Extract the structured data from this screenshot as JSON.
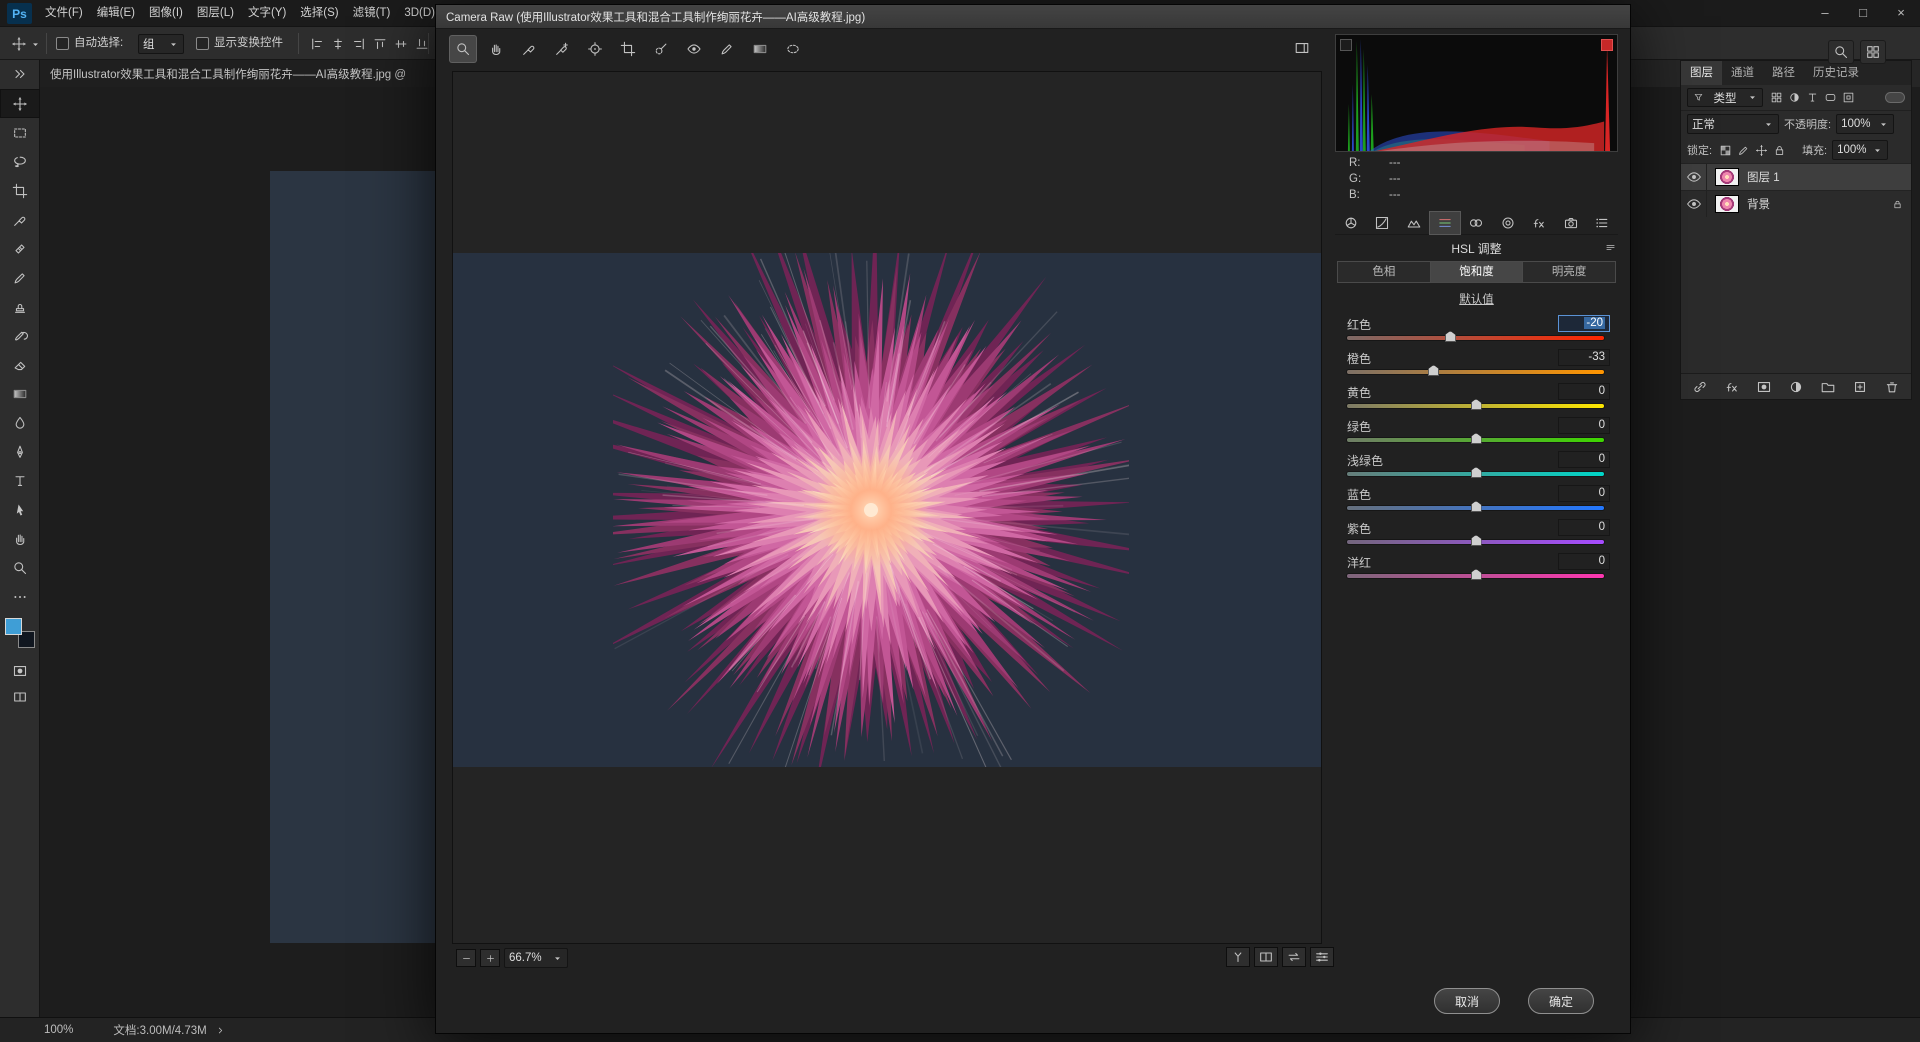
{
  "window_controls": {
    "minimize": "–",
    "maximize": "□",
    "close": "×"
  },
  "menu_bar": {
    "logo": "Ps",
    "items": [
      {
        "key": "file",
        "label": "文件(F)"
      },
      {
        "key": "edit",
        "label": "编辑(E)"
      },
      {
        "key": "image",
        "label": "图像(I)"
      },
      {
        "key": "layer",
        "label": "图层(L)"
      },
      {
        "key": "type",
        "label": "文字(Y)"
      },
      {
        "key": "select",
        "label": "选择(S)"
      },
      {
        "key": "filter",
        "label": "滤镜(T)"
      },
      {
        "key": "3d",
        "label": "3D(D)"
      }
    ]
  },
  "options_bar": {
    "auto_select_label": "自动选择:",
    "auto_select_value": "组",
    "show_transform_label": "显示变换控件",
    "align_icons": [
      {
        "name": "align-left-icon",
        "icon": "alignL"
      },
      {
        "name": "align-center-icon",
        "icon": "alignC"
      },
      {
        "name": "align-right-icon",
        "icon": "alignR"
      },
      {
        "name": "align-top-icon",
        "icon": "alignT"
      },
      {
        "name": "align-middle-icon",
        "icon": "alignM"
      },
      {
        "name": "align-bottom-icon",
        "icon": "alignB"
      }
    ]
  },
  "document_tab": {
    "title": "使用Illustrator效果工具和混合工具制作绚丽花卉——AI高级教程.jpg @"
  },
  "tools": {
    "items": [
      {
        "name": "move-tool",
        "icon": "move",
        "selected": true
      },
      {
        "name": "marquee-tool",
        "icon": "marquee"
      },
      {
        "name": "lasso-tool",
        "icon": "lasso"
      },
      {
        "name": "crop-tool",
        "icon": "crop"
      },
      {
        "name": "eyedropper-tool",
        "icon": "eyedropper"
      },
      {
        "name": "healing-brush-tool",
        "icon": "healing"
      },
      {
        "name": "brush-tool",
        "icon": "brush"
      },
      {
        "name": "clone-stamp-tool",
        "icon": "stamp"
      },
      {
        "name": "history-brush-tool",
        "icon": "history"
      },
      {
        "name": "eraser-tool",
        "icon": "eraser"
      },
      {
        "name": "gradient-tool",
        "icon": "gradient"
      },
      {
        "name": "blur-tool",
        "icon": "blur"
      },
      {
        "name": "pen-tool",
        "icon": "pen"
      },
      {
        "name": "type-tool",
        "icon": "type"
      },
      {
        "name": "path-selection-tool",
        "icon": "pathsel"
      },
      {
        "name": "hand-tool",
        "icon": "hand"
      },
      {
        "name": "zoom-tool",
        "icon": "zoom"
      }
    ],
    "foreground_color": "#3f9ed6",
    "background_color": "#10161f"
  },
  "status_bar": {
    "zoom": "100%",
    "doc_info": "文档:3.00M/4.73M"
  },
  "dialog": {
    "title": "Camera Raw (使用Illustrator效果工具和混合工具制作绚丽花卉——AI高级教程.jpg)",
    "toolbar": {
      "tools": [
        {
          "name": "cr-zoom-tool",
          "icon": "zoom",
          "selected": true
        },
        {
          "name": "cr-hand-tool",
          "icon": "hand"
        },
        {
          "name": "cr-white-balance-tool",
          "icon": "eyedropper"
        },
        {
          "name": "cr-color-sampler-tool",
          "icon": "sampler"
        },
        {
          "name": "cr-targeted-adjustment-tool",
          "icon": "target"
        },
        {
          "name": "cr-crop-tool",
          "icon": "crop"
        },
        {
          "name": "cr-spot-removal-tool",
          "icon": "spot"
        },
        {
          "name": "cr-red-eye-tool",
          "icon": "redeye"
        },
        {
          "name": "cr-adjustment-brush-tool",
          "icon": "brush"
        },
        {
          "name": "cr-graduated-filter-tool",
          "icon": "gradient"
        },
        {
          "name": "cr-radial-filter-tool",
          "icon": "radial"
        }
      ]
    },
    "zoom_level": "66.7%",
    "preview_controls": [
      {
        "name": "preview-mode-y-button",
        "icon": "ybox"
      },
      {
        "name": "preview-split-button",
        "icon": "split"
      },
      {
        "name": "preview-swap-button",
        "icon": "swap"
      },
      {
        "name": "preview-settings-button",
        "icon": "sliders"
      }
    ],
    "histogram": {
      "readouts": [
        {
          "label": "R:",
          "value": "---"
        },
        {
          "label": "G:",
          "value": "---"
        },
        {
          "label": "B:",
          "value": "---"
        }
      ]
    },
    "panel": {
      "tabs_icons": [
        {
          "name": "basic-panel",
          "icon": "basic"
        },
        {
          "name": "tone-curve-panel",
          "icon": "curve"
        },
        {
          "name": "detail-panel",
          "icon": "detail"
        },
        {
          "name": "hsl-panel",
          "icon": "hsl",
          "active": true
        },
        {
          "name": "split-toning-panel",
          "icon": "splittone"
        },
        {
          "name": "lens-corrections-panel",
          "icon": "lens"
        },
        {
          "name": "effects-panel",
          "icon": "fx"
        },
        {
          "name": "camera-calibration-panel",
          "icon": "camera"
        },
        {
          "name": "presets-panel",
          "icon": "presets"
        }
      ],
      "title": "HSL 调整",
      "tabs": [
        {
          "key": "hue",
          "label": "色相"
        },
        {
          "key": "saturation",
          "label": "饱和度",
          "active": true
        },
        {
          "key": "luminance",
          "label": "明亮度"
        }
      ],
      "default_link": "默认值",
      "sliders": [
        {
          "key": "red",
          "label": "红色",
          "value": "-20",
          "percent": 40,
          "track_from": "#7d6a66",
          "track_to": "#ff2600",
          "selected": true
        },
        {
          "key": "orange",
          "label": "橙色",
          "value": "-33",
          "percent": 33.5,
          "track_from": "#7d7066",
          "track_to": "#ff9500"
        },
        {
          "key": "yellow",
          "label": "黄色",
          "value": "0",
          "percent": 50,
          "track_from": "#7d7a66",
          "track_to": "#ffe800"
        },
        {
          "key": "green",
          "label": "绿色",
          "value": "0",
          "percent": 50,
          "track_from": "#6f7d66",
          "track_to": "#3ed600"
        },
        {
          "key": "aqua",
          "label": "浅绿色",
          "value": "0",
          "percent": 50,
          "track_from": "#667d7a",
          "track_to": "#00d6c8"
        },
        {
          "key": "blue",
          "label": "蓝色",
          "value": "0",
          "percent": 50,
          "track_from": "#66707d",
          "track_to": "#2277ff"
        },
        {
          "key": "purple",
          "label": "紫色",
          "value": "0",
          "percent": 50,
          "track_from": "#73667d",
          "track_to": "#a64bff"
        },
        {
          "key": "magenta",
          "label": "洋红",
          "value": "0",
          "percent": 50,
          "track_from": "#7d667a",
          "track_to": "#ff37b1"
        }
      ]
    },
    "cancel_label": "取消",
    "ok_label": "确定"
  },
  "layers_panel": {
    "tabs": [
      {
        "key": "layers",
        "label": "图层",
        "active": true
      },
      {
        "key": "channels",
        "label": "通道"
      },
      {
        "key": "paths",
        "label": "路径"
      },
      {
        "key": "history",
        "label": "历史记录"
      }
    ],
    "filter_label": "类型",
    "blend_mode": "正常",
    "opacity_label": "不透明度:",
    "opacity_value": "100%",
    "lock_label": "锁定:",
    "fill_label": "填充:",
    "fill_value": "100%",
    "layers": [
      {
        "name": "图层 1",
        "selected": true
      },
      {
        "name": "背景",
        "locked": true
      }
    ],
    "filter_icons": [
      {
        "name": "pixel-filter-icon",
        "icon": "grid4"
      },
      {
        "name": "adjustment-filter-icon",
        "icon": "halfcirc"
      },
      {
        "name": "type-filter-icon",
        "icon": "type"
      },
      {
        "name": "shape-filter-icon",
        "icon": "shape"
      },
      {
        "name": "smart-object-filter-icon",
        "icon": "smart"
      }
    ],
    "lock_icons": [
      {
        "name": "lock-transparency-icon",
        "icon": "checker"
      },
      {
        "name": "lock-pixels-icon",
        "icon": "brush"
      },
      {
        "name": "lock-position-icon",
        "icon": "move"
      },
      {
        "name": "lock-all-icon",
        "icon": "lock"
      }
    ],
    "bottom_icons": [
      {
        "name": "link-layers-icon",
        "icon": "link"
      },
      {
        "name": "layer-effects-icon",
        "icon": "fx"
      },
      {
        "name": "layer-mask-icon",
        "icon": "mask"
      },
      {
        "name": "adjustment-layer-icon",
        "icon": "halfcirc"
      },
      {
        "name": "layer-group-icon",
        "icon": "folder"
      },
      {
        "name": "new-layer-icon",
        "icon": "newlayer"
      },
      {
        "name": "delete-layer-icon",
        "icon": "trash"
      }
    ]
  }
}
